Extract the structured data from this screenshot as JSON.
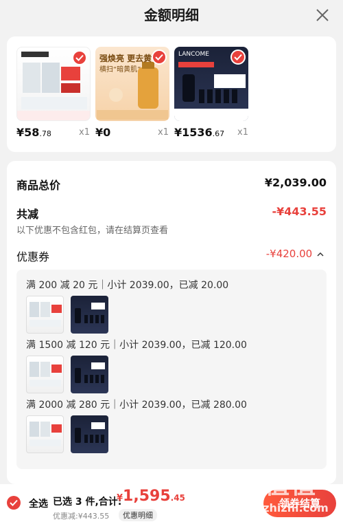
{
  "header": {
    "title": "金额明细"
  },
  "products": [
    {
      "price_int": "¥58",
      "price_dec": ".78",
      "qty": "x1"
    },
    {
      "price_int": "¥0",
      "price_dec": "",
      "qty": "x1",
      "overlay_line1": "强焕亮 更去黄",
      "overlay_line2": "横扫“暗黄肌”"
    },
    {
      "price_int": "¥1536",
      "price_dec": ".67",
      "qty": "x1",
      "brand": "LANCOME"
    }
  ],
  "summary": {
    "total_label": "商品总价",
    "total_value": "¥2,039.00",
    "discount_label": "共减",
    "discount_value": "-¥443.55",
    "discount_note": "以下优惠不包含红包，请在结算页查看",
    "coupon_label": "优惠券",
    "coupon_value": "-¥420.00"
  },
  "coupons": [
    {
      "line": "满 200 减 20 元｜小计 2039.00，已减 20.00"
    },
    {
      "line": "满 1500 减 120 元｜小计 2039.00，已减 120.00"
    },
    {
      "line": "满 2000 减 280 元｜小计 2039.00，已减 280.00"
    }
  ],
  "footer": {
    "select_all": "全选",
    "selected": "已选 3 件,合计:",
    "total_cur": "¥",
    "total_int": "1,595",
    "total_dec": ".45",
    "discount": "优惠减:¥443.55",
    "detail": "优惠明细",
    "checkout": "领券结算"
  },
  "watermark": {
    "text1": "值值值",
    "text2": "zhizhizhi.com"
  },
  "colors": {
    "accent": "#e8413c",
    "background": "#f2f2f2"
  }
}
